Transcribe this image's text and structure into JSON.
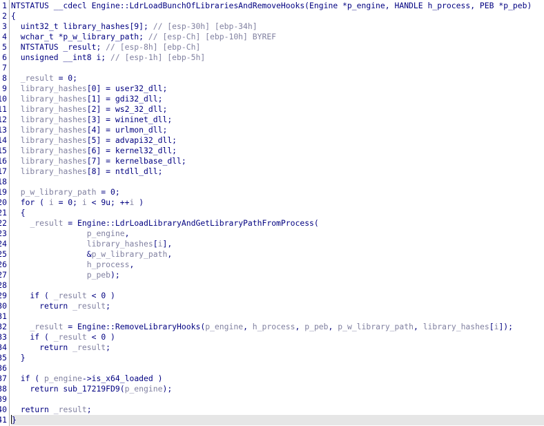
{
  "line_numbers": [
    "1",
    "2",
    "3",
    "4",
    "5",
    "6",
    "7",
    "8",
    "9",
    "10",
    "11",
    "12",
    "13",
    "14",
    "15",
    "16",
    "17",
    "18",
    "19",
    "20",
    "21",
    "22",
    "23",
    "24",
    "25",
    "26",
    "27",
    "28",
    "29",
    "30",
    "31",
    "32",
    "33",
    "34",
    "35",
    "36",
    "37",
    "38",
    "39",
    "40",
    "41"
  ],
  "lines": [
    [
      {
        "t": "NTSTATUS __cdecl Engine::LdrLoadBunchOfLibrariesAndRemoveHooks(Engine *p_engine, HANDLE h_process, PEB *p_peb)",
        "c": "kw"
      }
    ],
    [
      {
        "t": "{",
        "c": "kw"
      }
    ],
    [
      {
        "t": "  uint32_t library_hashes[9]; ",
        "c": "kw"
      },
      {
        "t": "// [esp-30h] [ebp-34h]",
        "c": "cmt"
      }
    ],
    [
      {
        "t": "  wchar_t *p_w_library_path; ",
        "c": "kw"
      },
      {
        "t": "// [esp-Ch] [ebp-10h] BYREF",
        "c": "cmt"
      }
    ],
    [
      {
        "t": "  NTSTATUS _result; ",
        "c": "kw"
      },
      {
        "t": "// [esp-8h] [ebp-Ch]",
        "c": "cmt"
      }
    ],
    [
      {
        "t": "  unsigned __int8 i; ",
        "c": "kw"
      },
      {
        "t": "// [esp-1h] [ebp-5h]",
        "c": "cmt"
      }
    ],
    [
      {
        "t": "",
        "c": "kw"
      }
    ],
    [
      {
        "t": "  ",
        "c": "kw"
      },
      {
        "t": "_result",
        "c": "var"
      },
      {
        "t": " = 0;",
        "c": "kw"
      }
    ],
    [
      {
        "t": "  ",
        "c": "kw"
      },
      {
        "t": "library_hashes",
        "c": "var"
      },
      {
        "t": "[0] = user32_dll;",
        "c": "kw"
      }
    ],
    [
      {
        "t": "  ",
        "c": "kw"
      },
      {
        "t": "library_hashes",
        "c": "var"
      },
      {
        "t": "[1] = gdi32_dll;",
        "c": "kw"
      }
    ],
    [
      {
        "t": "  ",
        "c": "kw"
      },
      {
        "t": "library_hashes",
        "c": "var"
      },
      {
        "t": "[2] = ws2_32_dll;",
        "c": "kw"
      }
    ],
    [
      {
        "t": "  ",
        "c": "kw"
      },
      {
        "t": "library_hashes",
        "c": "var"
      },
      {
        "t": "[3] = wininet_dll;",
        "c": "kw"
      }
    ],
    [
      {
        "t": "  ",
        "c": "kw"
      },
      {
        "t": "library_hashes",
        "c": "var"
      },
      {
        "t": "[4] = urlmon_dll;",
        "c": "kw"
      }
    ],
    [
      {
        "t": "  ",
        "c": "kw"
      },
      {
        "t": "library_hashes",
        "c": "var"
      },
      {
        "t": "[5] = advapi32_dll;",
        "c": "kw"
      }
    ],
    [
      {
        "t": "  ",
        "c": "kw"
      },
      {
        "t": "library_hashes",
        "c": "var"
      },
      {
        "t": "[6] = kernel32_dll;",
        "c": "kw"
      }
    ],
    [
      {
        "t": "  ",
        "c": "kw"
      },
      {
        "t": "library_hashes",
        "c": "var"
      },
      {
        "t": "[7] = kernelbase_dll;",
        "c": "kw"
      }
    ],
    [
      {
        "t": "  ",
        "c": "kw"
      },
      {
        "t": "library_hashes",
        "c": "var"
      },
      {
        "t": "[8] = ntdll_dll;",
        "c": "kw"
      }
    ],
    [
      {
        "t": "",
        "c": "kw"
      }
    ],
    [
      {
        "t": "  ",
        "c": "kw"
      },
      {
        "t": "p_w_library_path",
        "c": "var"
      },
      {
        "t": " = 0;",
        "c": "kw"
      }
    ],
    [
      {
        "t": "  for ( ",
        "c": "kw"
      },
      {
        "t": "i",
        "c": "var"
      },
      {
        "t": " = 0; ",
        "c": "kw"
      },
      {
        "t": "i",
        "c": "var"
      },
      {
        "t": " < 9u; ++",
        "c": "kw"
      },
      {
        "t": "i",
        "c": "var"
      },
      {
        "t": " )",
        "c": "kw"
      }
    ],
    [
      {
        "t": "  {",
        "c": "kw"
      }
    ],
    [
      {
        "t": "    ",
        "c": "kw"
      },
      {
        "t": "_result",
        "c": "var"
      },
      {
        "t": " = Engine::LdrLoadLibraryAndGetLibraryPathFromProcess(",
        "c": "kw"
      }
    ],
    [
      {
        "t": "                ",
        "c": "kw"
      },
      {
        "t": "p_engine",
        "c": "var"
      },
      {
        "t": ",",
        "c": "kw"
      }
    ],
    [
      {
        "t": "                ",
        "c": "kw"
      },
      {
        "t": "library_hashes",
        "c": "var"
      },
      {
        "t": "[",
        "c": "kw"
      },
      {
        "t": "i",
        "c": "var"
      },
      {
        "t": "],",
        "c": "kw"
      }
    ],
    [
      {
        "t": "                &",
        "c": "kw"
      },
      {
        "t": "p_w_library_path",
        "c": "var"
      },
      {
        "t": ",",
        "c": "kw"
      }
    ],
    [
      {
        "t": "                ",
        "c": "kw"
      },
      {
        "t": "h_process",
        "c": "var"
      },
      {
        "t": ",",
        "c": "kw"
      }
    ],
    [
      {
        "t": "                ",
        "c": "kw"
      },
      {
        "t": "p_peb",
        "c": "var"
      },
      {
        "t": ");",
        "c": "kw"
      }
    ],
    [
      {
        "t": "",
        "c": "kw"
      }
    ],
    [
      {
        "t": "    if ( ",
        "c": "kw"
      },
      {
        "t": "_result",
        "c": "var"
      },
      {
        "t": " < 0 )",
        "c": "kw"
      }
    ],
    [
      {
        "t": "      return ",
        "c": "kw"
      },
      {
        "t": "_result",
        "c": "var"
      },
      {
        "t": ";",
        "c": "kw"
      }
    ],
    [
      {
        "t": "",
        "c": "kw"
      }
    ],
    [
      {
        "t": "    ",
        "c": "kw"
      },
      {
        "t": "_result",
        "c": "var"
      },
      {
        "t": " = Engine::RemoveLibraryHooks(",
        "c": "kw"
      },
      {
        "t": "p_engine",
        "c": "var"
      },
      {
        "t": ", ",
        "c": "kw"
      },
      {
        "t": "h_process",
        "c": "var"
      },
      {
        "t": ", ",
        "c": "kw"
      },
      {
        "t": "p_peb",
        "c": "var"
      },
      {
        "t": ", ",
        "c": "kw"
      },
      {
        "t": "p_w_library_path",
        "c": "var"
      },
      {
        "t": ", ",
        "c": "kw"
      },
      {
        "t": "library_hashes",
        "c": "var"
      },
      {
        "t": "[",
        "c": "kw"
      },
      {
        "t": "i",
        "c": "var"
      },
      {
        "t": "]);",
        "c": "kw"
      }
    ],
    [
      {
        "t": "    if ( ",
        "c": "kw"
      },
      {
        "t": "_result",
        "c": "var"
      },
      {
        "t": " < 0 )",
        "c": "kw"
      }
    ],
    [
      {
        "t": "      return ",
        "c": "kw"
      },
      {
        "t": "_result",
        "c": "var"
      },
      {
        "t": ";",
        "c": "kw"
      }
    ],
    [
      {
        "t": "  }",
        "c": "kw"
      }
    ],
    [
      {
        "t": "",
        "c": "kw"
      }
    ],
    [
      {
        "t": "  if ( ",
        "c": "kw"
      },
      {
        "t": "p_engine",
        "c": "var"
      },
      {
        "t": "->is_x64_loaded )",
        "c": "kw"
      }
    ],
    [
      {
        "t": "    return sub_17219FD9(",
        "c": "kw"
      },
      {
        "t": "p_engine",
        "c": "var"
      },
      {
        "t": ");",
        "c": "kw"
      }
    ],
    [
      {
        "t": "",
        "c": "kw"
      }
    ],
    [
      {
        "t": "  return ",
        "c": "kw"
      },
      {
        "t": "_result",
        "c": "var"
      },
      {
        "t": ";",
        "c": "kw"
      }
    ],
    [
      {
        "t": "}",
        "c": "kw"
      }
    ]
  ],
  "current_line_index": 40
}
